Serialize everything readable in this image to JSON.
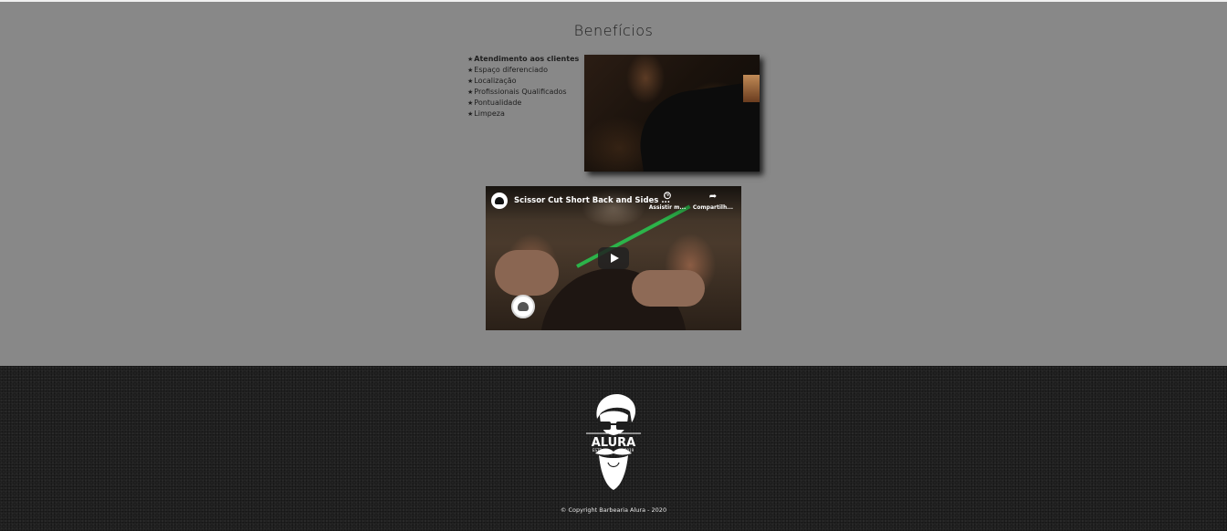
{
  "benefits": {
    "title": "Benefícios",
    "items": [
      {
        "label": "Atendimento aos clientes"
      },
      {
        "label": "Espaço diferenciado"
      },
      {
        "label": "Localização"
      },
      {
        "label": "Profissionais Qualificados"
      },
      {
        "label": "Pontualidade"
      },
      {
        "label": "Limpeza"
      }
    ],
    "bullet_icon": "star-icon"
  },
  "video": {
    "title": "Scissor Cut Short Back and Sides ...",
    "watch_later_label": "Assistir m...",
    "share_label": "Compartilh...",
    "play_icon": "play-icon",
    "accent_color": "#2cb34a"
  },
  "footer": {
    "logo_text": "ALURA",
    "logo_left": "ESTD",
    "logo_right": "2019",
    "copyright": "© Copyright Barbearia Alura - 2020"
  },
  "colors": {
    "section_bg": "#888888",
    "footer_bg": "#222222",
    "text": "#1e1e1e"
  }
}
